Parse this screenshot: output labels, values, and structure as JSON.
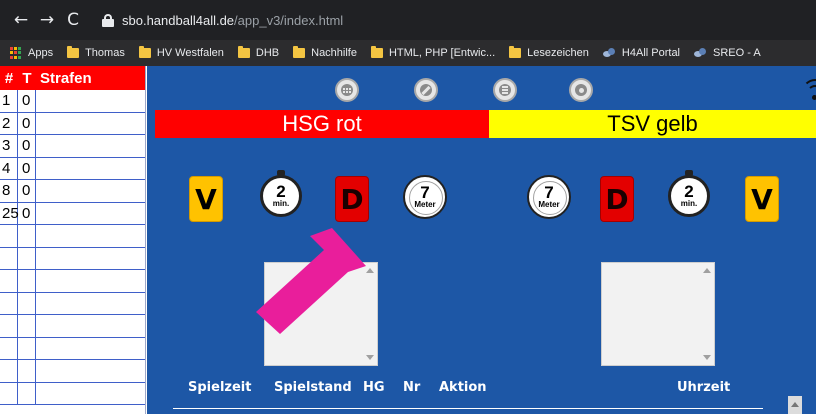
{
  "browser": {
    "nav": {
      "back": "←",
      "forward": "→",
      "reload": "C"
    },
    "url": {
      "host": "sbo.handball4all.de",
      "path": "/app_v3/index.html"
    },
    "bookmarks": [
      "Apps",
      "Thomas",
      "HV Westfalen",
      "DHB",
      "Nachhilfe",
      "HTML, PHP [Entwic...",
      "Lesezeichen",
      "H4All Portal",
      "SREO - A"
    ]
  },
  "penalties": {
    "headers": {
      "number": "#",
      "t": "T",
      "strafen": "Strafen"
    },
    "rows": [
      {
        "number": "1",
        "t": "0",
        "strafen": ""
      },
      {
        "number": "2",
        "t": "0",
        "strafen": ""
      },
      {
        "number": "3",
        "t": "0",
        "strafen": ""
      },
      {
        "number": "4",
        "t": "0",
        "strafen": ""
      },
      {
        "number": "8",
        "t": "0",
        "strafen": ""
      },
      {
        "number": "25",
        "t": "0",
        "strafen": ""
      },
      {
        "number": "",
        "t": "",
        "strafen": ""
      },
      {
        "number": "",
        "t": "",
        "strafen": ""
      },
      {
        "number": "",
        "t": "",
        "strafen": ""
      },
      {
        "number": "",
        "t": "",
        "strafen": ""
      },
      {
        "number": "",
        "t": "",
        "strafen": ""
      },
      {
        "number": "",
        "t": "",
        "strafen": ""
      },
      {
        "number": "",
        "t": "",
        "strafen": ""
      },
      {
        "number": "",
        "t": "",
        "strafen": ""
      }
    ]
  },
  "toolbar": {
    "icons": [
      "grid-icon",
      "pencil-icon",
      "list-icon",
      "gear-icon",
      "wifi-icon"
    ]
  },
  "teams": {
    "home": {
      "name": "HSG rot",
      "color": "#ff0000"
    },
    "away": {
      "name": "TSV gelb",
      "color": "#ffff00"
    }
  },
  "actions": {
    "warning": "V",
    "suspension_number": "2",
    "suspension_unit": "min.",
    "disqualification": "D",
    "penalty_number": "7",
    "penalty_unit": "Meter"
  },
  "log_columns": [
    "Spielzeit",
    "Spielstand",
    "HG",
    "Nr",
    "Aktion",
    "Uhrzeit"
  ],
  "colors": {
    "main_bg": "#1d57a6",
    "arrow": "#e91e9b",
    "penalty_header": "#ff0000"
  }
}
